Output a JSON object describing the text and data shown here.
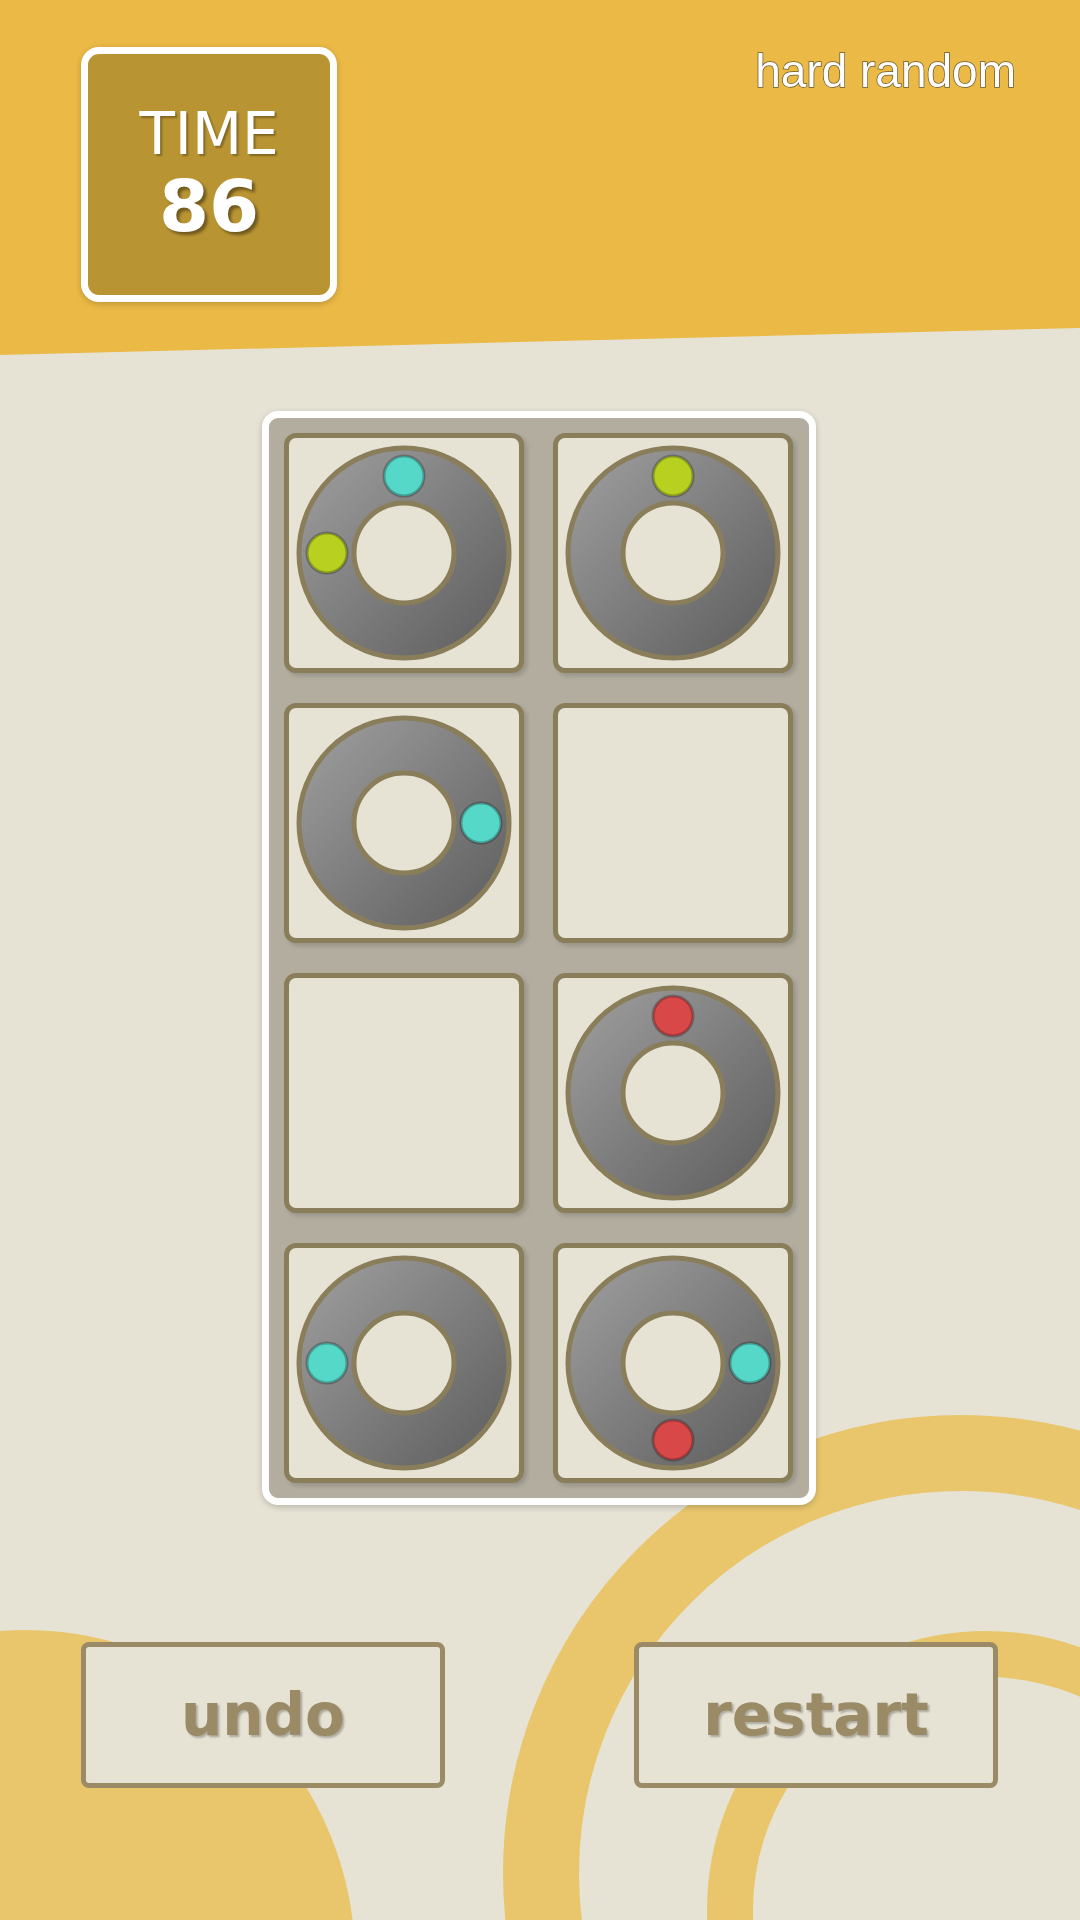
{
  "timer": {
    "label": "TIME",
    "value": "86"
  },
  "mode": "hard random",
  "board": {
    "cells": [
      {
        "kind": "ring",
        "dots": [
          {
            "kind": "top",
            "color": "#55d8c8"
          },
          {
            "kind": "left",
            "color": "#b8d020"
          }
        ]
      },
      {
        "kind": "ring",
        "dots": [
          {
            "kind": "top",
            "color": "#b8d020"
          }
        ]
      },
      {
        "kind": "ring",
        "dots": [
          {
            "kind": "right",
            "color": "#55d8c8"
          }
        ]
      },
      {
        "kind": "empty"
      },
      {
        "kind": "empty"
      },
      {
        "kind": "ring",
        "dots": [
          {
            "kind": "top",
            "color": "#d84848"
          }
        ]
      },
      {
        "kind": "ring",
        "dots": [
          {
            "kind": "left",
            "color": "#55d8c8"
          }
        ]
      },
      {
        "kind": "ring",
        "dots": [
          {
            "kind": "right",
            "color": "#55d8c8"
          },
          {
            "kind": "bottom",
            "color": "#d84848"
          }
        ]
      }
    ]
  },
  "buttons": [
    "undo",
    "restart"
  ]
}
